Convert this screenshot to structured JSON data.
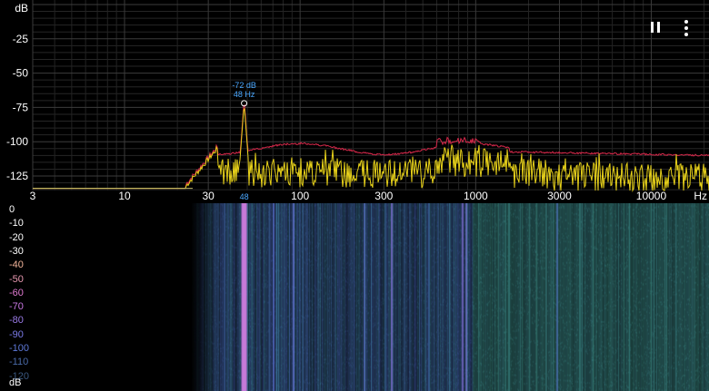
{
  "spectrum": {
    "unit_db": "dB",
    "unit_hz": "Hz",
    "db_ticks": [
      {
        "value": -25,
        "label": "-25"
      },
      {
        "value": -50,
        "label": "-50"
      },
      {
        "value": -75,
        "label": "-75"
      },
      {
        "value": -100,
        "label": "-100"
      },
      {
        "value": -125,
        "label": "-125"
      }
    ],
    "hz_ticks": [
      {
        "value": 3,
        "label": "3"
      },
      {
        "value": 10,
        "label": "10"
      },
      {
        "value": 30,
        "label": "30"
      },
      {
        "value": 100,
        "label": "100"
      },
      {
        "value": 300,
        "label": "300"
      },
      {
        "value": 1000,
        "label": "1000"
      },
      {
        "value": 3000,
        "label": "3000"
      },
      {
        "value": 10000,
        "label": "10000"
      }
    ],
    "peak": {
      "freq": 48,
      "db": -72,
      "db_label": "-72 dB",
      "freq_label": "48 Hz",
      "axis_label": "48"
    }
  },
  "spectrogram": {
    "unit": "dB",
    "scale_labels": [
      {
        "label": "0",
        "color": "#ffffff"
      },
      {
        "label": "-10",
        "color": "#ffffff"
      },
      {
        "label": "-20",
        "color": "#ffffff"
      },
      {
        "label": "-30",
        "color": "#ffffff"
      },
      {
        "label": "-40",
        "color": "#f2b49a"
      },
      {
        "label": "-50",
        "color": "#e898b0"
      },
      {
        "label": "-60",
        "color": "#e07ad0"
      },
      {
        "label": "-70",
        "color": "#c877e2"
      },
      {
        "label": "-80",
        "color": "#9a7ae6"
      },
      {
        "label": "-90",
        "color": "#7a7ae8"
      },
      {
        "label": "-100",
        "color": "#5e79d8"
      },
      {
        "label": "-110",
        "color": "#4a6aa8"
      },
      {
        "label": "-120",
        "color": "#3a5880"
      }
    ]
  },
  "controls": {
    "pause_icon": "pause-icon",
    "more_icon": "more-vert-icon"
  }
}
